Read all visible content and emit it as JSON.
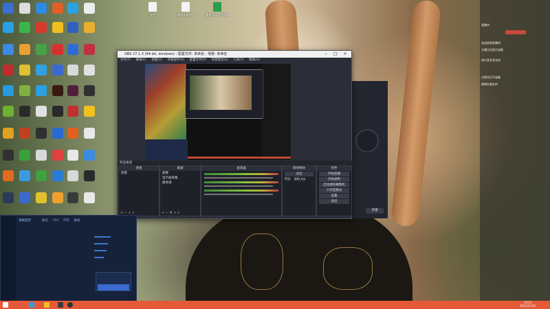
{
  "desktop_files": [
    {
      "label": "文件"
    },
    {
      "label": "新建文本文档"
    },
    {
      "label": "新建 XLSX 工作表"
    }
  ],
  "obs": {
    "title": "OBS 27.1.3 (64-bit, windows) - 配置文件: 未命名 - 场景: 未命名",
    "menu": [
      "文件(F)",
      "编辑(E)",
      "视图(V)",
      "停靠部件(D)",
      "配置文件(P)",
      "场景集合(S)",
      "工具(T)",
      "帮助(H)"
    ],
    "source_bar": "所选来源",
    "docks": {
      "scenes": "场景",
      "sources": "来源",
      "mixer": "混音器",
      "transitions": "转场特效",
      "controls": "控件"
    },
    "scene_item": "场景",
    "sources": [
      "图像",
      "显示器采集",
      "媒体源"
    ],
    "transition": "淡出",
    "duration_label": "时长",
    "duration_value": "300 ms",
    "controls": [
      "开始直播",
      "开始录制",
      "启动虚拟摄像机",
      "工作室模式",
      "设置",
      "退出"
    ]
  },
  "sidebar": {
    "header": "直播中",
    "lines": [
      "欢迎来到直播间",
      "主播正在努力加载",
      "请大家多多支持",
      "点赞关注不迷路",
      "感谢礼物支持"
    ]
  },
  "panel": {
    "button": "开播"
  },
  "monitor": {
    "title": "系统监控",
    "tabs": [
      "概览",
      "CPU",
      "内存",
      "磁盘"
    ]
  },
  "clock": {
    "time": "10:21",
    "date": "2021/12/30"
  }
}
